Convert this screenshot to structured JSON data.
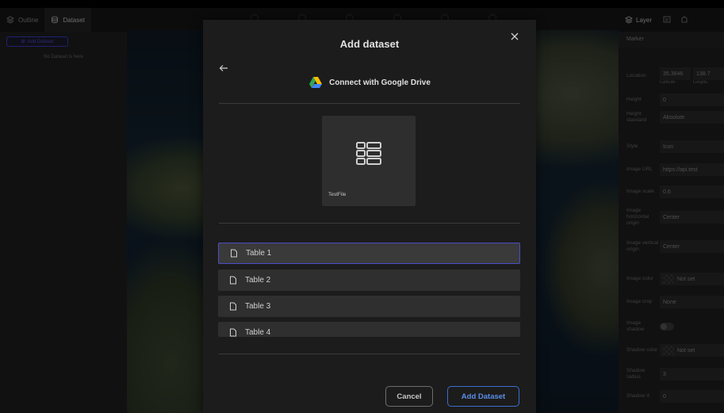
{
  "left_panel": {
    "tabs": [
      {
        "label": "Outline"
      },
      {
        "label": "Dataset"
      }
    ],
    "add_dataset_label": "Add Dataset",
    "empty_text": "No Dataset is here"
  },
  "right_panel": {
    "tabs": [
      {
        "label": "Layer"
      }
    ],
    "section_title": "Marker",
    "properties": {
      "location": {
        "label": "Location",
        "lat_value": "35.3646",
        "lng_value": "138.7",
        "lat_sub": "Latitude",
        "lng_sub": "Longitu"
      },
      "height": {
        "label": "Height",
        "value": "0"
      },
      "height_standard": {
        "label": "Height standard",
        "value": "Absolute"
      },
      "style": {
        "label": "Style",
        "value": "Icon"
      },
      "image_url": {
        "label": "Image URL",
        "value": "https://api.test"
      },
      "image_scale": {
        "label": "Image scale",
        "value": "0.6"
      },
      "image_h_origin": {
        "label": "Image horizontal origin",
        "value": "Center"
      },
      "image_v_origin": {
        "label": "Image vertical origin",
        "value": "Center"
      },
      "image_color": {
        "label": "Image color",
        "value": "Not set"
      },
      "image_crop": {
        "label": "Image crop",
        "value": "None"
      },
      "image_shadow": {
        "label": "Image shadow"
      },
      "shadow_color": {
        "label": "Shadow color",
        "value": "Not set"
      },
      "shadow_radius": {
        "label": "Shadow radius",
        "value": "3"
      },
      "shadow_x": {
        "label": "Shadow X",
        "value": "0"
      }
    }
  },
  "modal": {
    "title": "Add dataset",
    "connect_label": "Connect with Google Drive",
    "file": {
      "name": "TestFile"
    },
    "tables": [
      {
        "label": "Table 1",
        "selected": true
      },
      {
        "label": "Table 2",
        "selected": false
      },
      {
        "label": "Table 3",
        "selected": false
      },
      {
        "label": "Table 4",
        "selected": false
      }
    ],
    "cancel_label": "Cancel",
    "add_label": "Add Dataset"
  },
  "colors": {
    "accent": "#4c4cc8",
    "primary_button": "#3b6fd0",
    "modal_bg": "#1c1c1c"
  },
  "icons": {
    "close": "close-icon",
    "back": "arrow-left-icon",
    "drive": "google-drive-icon",
    "sheet": "spreadsheet-icon",
    "file": "file-icon"
  }
}
